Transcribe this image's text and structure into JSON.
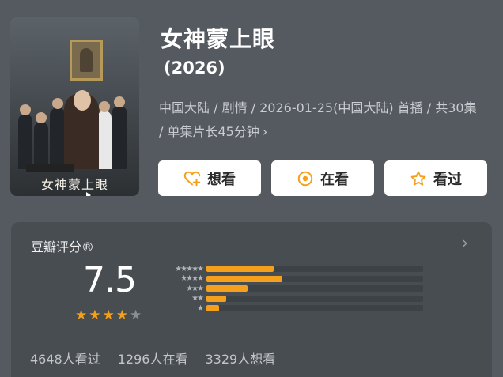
{
  "movie": {
    "title": "女神蒙上眼",
    "year": "(2026)",
    "meta": "中国大陆 / 剧情 / 2026-01-25(中国大陆) 首播 / 共30集 / 单集片长45分钟",
    "poster_title": "女神蒙上眼"
  },
  "actions": {
    "want": "想看",
    "watching": "在看",
    "watched": "看过"
  },
  "rating": {
    "label": "豆瓣评分®",
    "score": "7.5",
    "star_count": 4,
    "star_max": 5,
    "distribution": [
      {
        "stars": "★★★★★",
        "fraction": 0.31
      },
      {
        "stars": "★★★★",
        "fraction": 0.35
      },
      {
        "stars": "★★★",
        "fraction": 0.19
      },
      {
        "stars": "★★",
        "fraction": 0.09
      },
      {
        "stars": "★",
        "fraction": 0.06
      }
    ]
  },
  "counts": {
    "watched": "4648人看过",
    "watching": "1296人在看",
    "want": "3329人想看"
  },
  "colors": {
    "accent": "#f5a01c",
    "background": "#555a60",
    "card": "#484d52"
  }
}
